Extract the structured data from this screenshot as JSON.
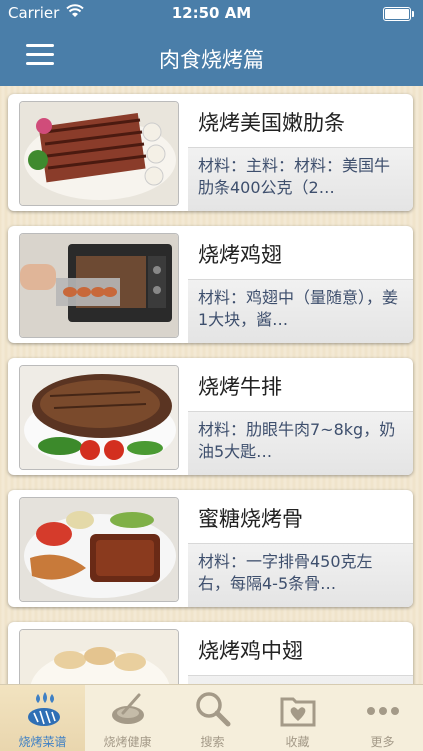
{
  "status_bar": {
    "carrier": "Carrier",
    "time": "12:50 AM"
  },
  "nav": {
    "title": "肉食烧烤篇"
  },
  "recipes": [
    {
      "title": "烧烤美国嫩肋条",
      "desc": "材料：主料：材料：美国牛肋条400公克（2…"
    },
    {
      "title": "烧烤鸡翅",
      "desc": "材料：鸡翅中（量随意），姜1大块，酱…"
    },
    {
      "title": "烧烤牛排",
      "desc": "材料：肋眼牛肉7~8kg，奶油5大匙…"
    },
    {
      "title": "蜜糖烧烤骨",
      "desc": "材料：一字排骨450克左右，每隔4-5条骨…"
    },
    {
      "title": "烧烤鸡中翅",
      "desc": ""
    }
  ],
  "tabs": [
    {
      "label": "烧烤菜谱",
      "icon": "bbq-grill-icon",
      "active": true
    },
    {
      "label": "烧烤健康",
      "icon": "plate-icon",
      "active": false
    },
    {
      "label": "搜索",
      "icon": "search-icon",
      "active": false
    },
    {
      "label": "收藏",
      "icon": "favorites-folder-icon",
      "active": false
    },
    {
      "label": "更多",
      "icon": "more-dots-icon",
      "active": false
    }
  ],
  "colors": {
    "nav_bar": "#4a7ea9",
    "tab_active": "#3f80c4",
    "tab_inactive": "#a49a88",
    "desc_text": "#3e4f6d"
  }
}
